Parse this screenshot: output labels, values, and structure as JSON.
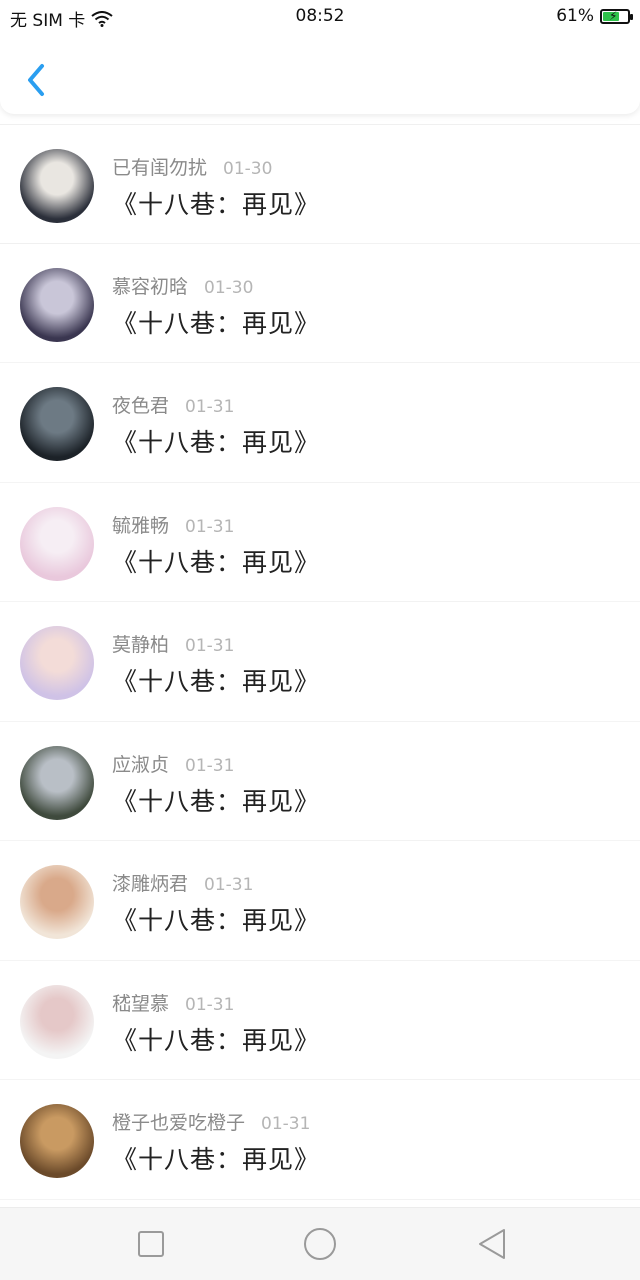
{
  "status_bar": {
    "carrier": "无 SIM 卡",
    "time": "08:52",
    "battery": "61%",
    "battery_level": 0.61
  },
  "header": {
    "back_icon": "chevron-left-icon",
    "accent": "#2a9ef0"
  },
  "messages": [
    {
      "name": "已有闺勿扰",
      "date": "01-30",
      "title": "《十八巷：再见》",
      "avatar_colors": [
        "#2b2f3a",
        "#e9e6e1"
      ]
    },
    {
      "name": "慕容初晗",
      "date": "01-30",
      "title": "《十八巷：再见》",
      "avatar_colors": [
        "#3a3650",
        "#c9c6d8"
      ]
    },
    {
      "name": "夜色君",
      "date": "01-31",
      "title": "《十八巷：再见》",
      "avatar_colors": [
        "#1c2228",
        "#6d7a84"
      ]
    },
    {
      "name": "毓雅畅",
      "date": "01-31",
      "title": "《十八巷：再见》",
      "avatar_colors": [
        "#e9c8dc",
        "#f6eef4"
      ]
    },
    {
      "name": "莫静柏",
      "date": "01-31",
      "title": "《十八巷：再见》",
      "avatar_colors": [
        "#cfc2e6",
        "#f3dcd8"
      ]
    },
    {
      "name": "应淑贞",
      "date": "01-31",
      "title": "《十八巷：再见》",
      "avatar_colors": [
        "#3f4a3d",
        "#b9bfc6"
      ]
    },
    {
      "name": "漆雕炳君",
      "date": "01-31",
      "title": "《十八巷：再见》",
      "avatar_colors": [
        "#f1e5d8",
        "#d9a98a"
      ]
    },
    {
      "name": "嵇望慕",
      "date": "01-31",
      "title": "《十八巷：再见》",
      "avatar_colors": [
        "#f4f4f4",
        "#e5c8c8"
      ]
    },
    {
      "name": "橙子也爱吃橙子",
      "date": "01-31",
      "title": "《十八巷：再见》",
      "avatar_colors": [
        "#6b4a2a",
        "#c99a62"
      ]
    }
  ],
  "navbar": {
    "recent_icon": "square-icon",
    "home_icon": "circle-icon",
    "back_icon": "triangle-back-icon"
  }
}
